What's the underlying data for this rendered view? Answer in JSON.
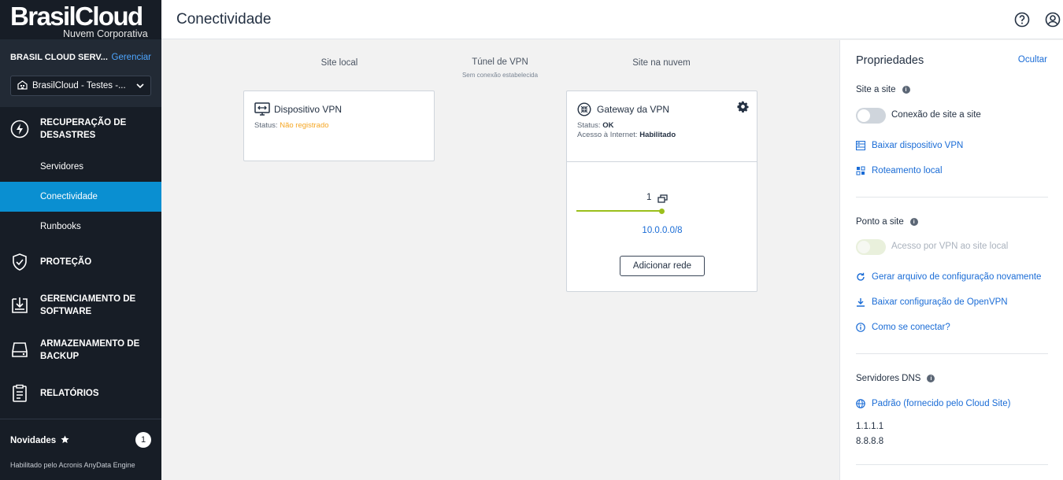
{
  "sidebar": {
    "logo_main": "BrasilCloud",
    "logo_sub": "Nuvem Corporativa",
    "tenant": "BRASIL CLOUD SERV...",
    "manage_label": "Gerenciar",
    "tenant_select": "BrasilCloud - Testes -...",
    "groups": [
      {
        "label": "RECUPERAÇÃO DE DESASTRES",
        "icon": "bolt-icon"
      },
      {
        "label": "PROTEÇÃO",
        "icon": "shield-check-icon"
      },
      {
        "label": "GERENCIAMENTO DE SOFTWARE",
        "icon": "software-download-icon"
      },
      {
        "label": "ARMAZENAMENTO DE BACKUP",
        "icon": "storage-drive-icon"
      },
      {
        "label": "RELATÓRIOS",
        "icon": "report-clipboard-icon"
      }
    ],
    "subitems": [
      {
        "label": "Servidores"
      },
      {
        "label": "Conectividade",
        "active": true
      },
      {
        "label": "Runbooks"
      }
    ],
    "news_label": "Novidades",
    "news_count": "1",
    "engine_text": "Habilitado pelo Acronis AnyData Engine"
  },
  "header": {
    "title": "Conectividade",
    "icons": [
      "help-icon",
      "account-icon"
    ]
  },
  "main": {
    "col_local": "Site local",
    "col_tunnel": "Túnel de VPN",
    "col_tunnel_sub": "Sem conexão estabelecida",
    "col_cloud": "Site na nuvem",
    "local_card": {
      "title": "Dispositivo VPN",
      "status_label": "Status:",
      "status_value": "Não registrado"
    },
    "cloud_card": {
      "title": "Gateway da VPN",
      "status_label": "Status:",
      "status_value": "OK",
      "internet_label": "Acesso à Internet:",
      "internet_value": "Habilitado",
      "network_count": "1",
      "network": "10.0.0.0/8",
      "add_network_label": "Adicionar rede"
    }
  },
  "props": {
    "title": "Propriedades",
    "hide_label": "Ocultar",
    "site_to_site": {
      "title": "Site a site",
      "toggle_label": "Conexão de site a site",
      "toggle_on": false,
      "links": [
        "Baixar dispositivo VPN",
        "Roteamento local"
      ]
    },
    "point_to_site": {
      "title": "Ponto a site",
      "toggle_label": "Acesso por VPN ao site local",
      "toggle_disabled": true,
      "links": [
        "Gerar arquivo de configuração novamente",
        "Baixar configuração de OpenVPN",
        "Como se conectar?"
      ]
    },
    "dns": {
      "title": "Servidores DNS",
      "link": "Padrão (fornecido pelo Cloud Site)",
      "servers": [
        "1.1.1.1",
        "8.8.8.8"
      ]
    }
  },
  "colors": {
    "sidebar_bg": "#171d26",
    "active_blue": "#0a8fd1",
    "link_blue": "#1a6cd6",
    "warning_orange": "#f5a623",
    "network_green": "#9bbf1c"
  }
}
